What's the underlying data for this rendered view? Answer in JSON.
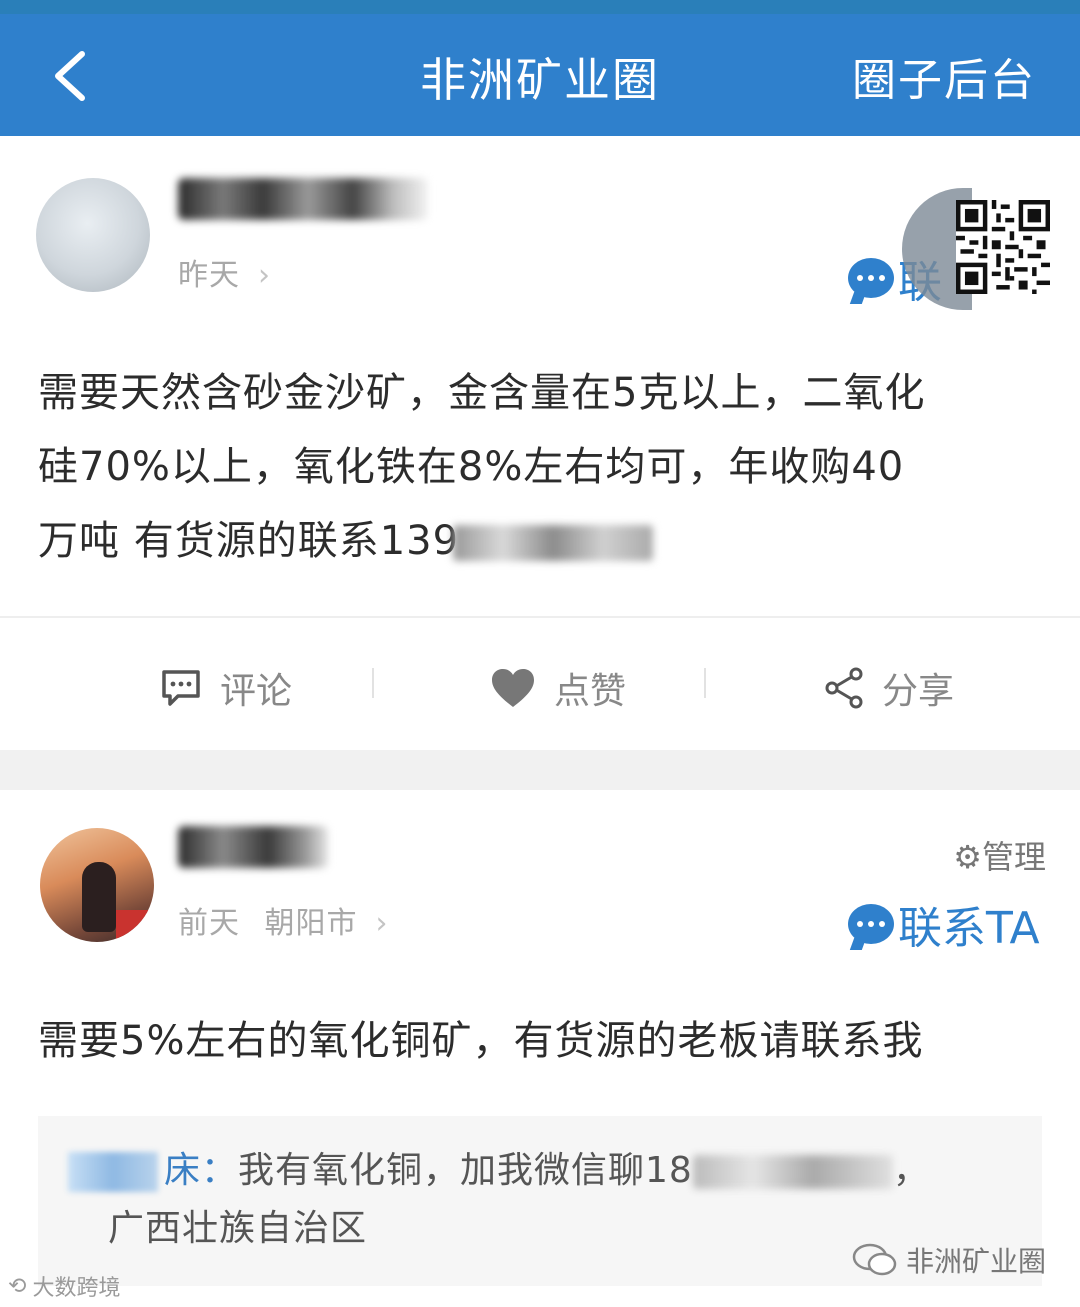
{
  "header": {
    "title": "非洲矿业圈",
    "right_action": "圈子后台"
  },
  "posts": [
    {
      "time": "昨天",
      "location": "",
      "contact_label": "联",
      "text_line1": "需要天然含砂金沙矿，金含量在5克以上，二氧化",
      "text_line2": "硅70%以上，氧化铁在8%左右均可，年收购40",
      "text_line3": "万吨 有货源的联系139",
      "actions": {
        "comment": "评论",
        "like": "点赞",
        "share": "分享"
      }
    },
    {
      "time": "前天",
      "location": "朝阳市",
      "manage_label": "管理",
      "contact_label": "联系TA",
      "text": "需要5%左右的氧化铜矿，有货源的老板请联系我",
      "comment": {
        "name_suffix": "床：",
        "text_a": "我有氧化铜，加我微信聊18",
        "text_b": "，",
        "text_c": "广西壮族自治区"
      }
    }
  ],
  "watermarks": {
    "right": "非洲矿业圈",
    "left": "大数跨境"
  },
  "colors": {
    "accent": "#2f80cc",
    "header_bg": "#2f80cc"
  }
}
